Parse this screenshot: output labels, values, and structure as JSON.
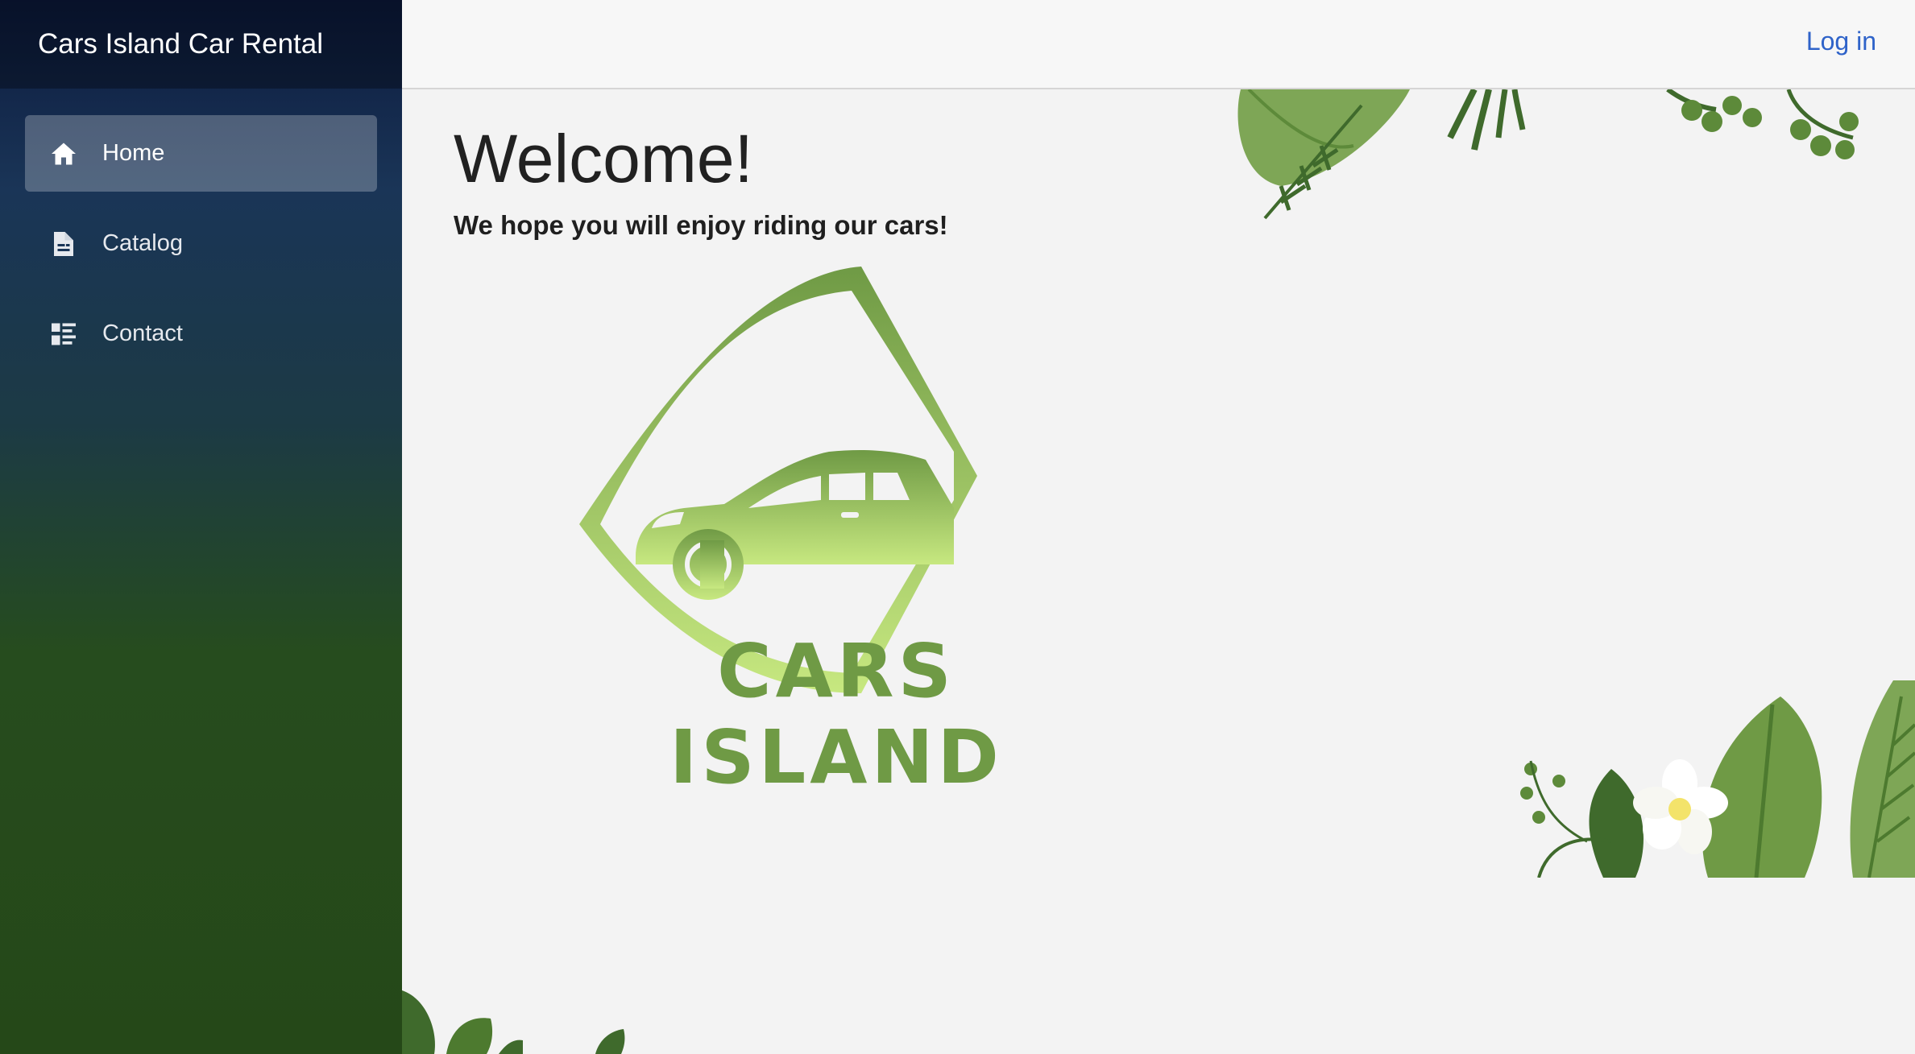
{
  "app": {
    "brand": "Cars Island Car Rental"
  },
  "nav": {
    "items": [
      {
        "label": "Home",
        "icon": "home-icon",
        "active": true
      },
      {
        "label": "Catalog",
        "icon": "catalog-icon",
        "active": false
      },
      {
        "label": "Contact",
        "icon": "contact-icon",
        "active": false
      }
    ]
  },
  "header": {
    "login_label": "Log in"
  },
  "main": {
    "title": "Welcome!",
    "subtitle": "We hope you will enjoy riding our cars!",
    "logo_text": "CARS ISLAND"
  },
  "colors": {
    "link": "#2f63c9",
    "logo_green": "#6f9a45",
    "sidebar_top": "#0c1a3e",
    "sidebar_bottom": "#254818"
  }
}
